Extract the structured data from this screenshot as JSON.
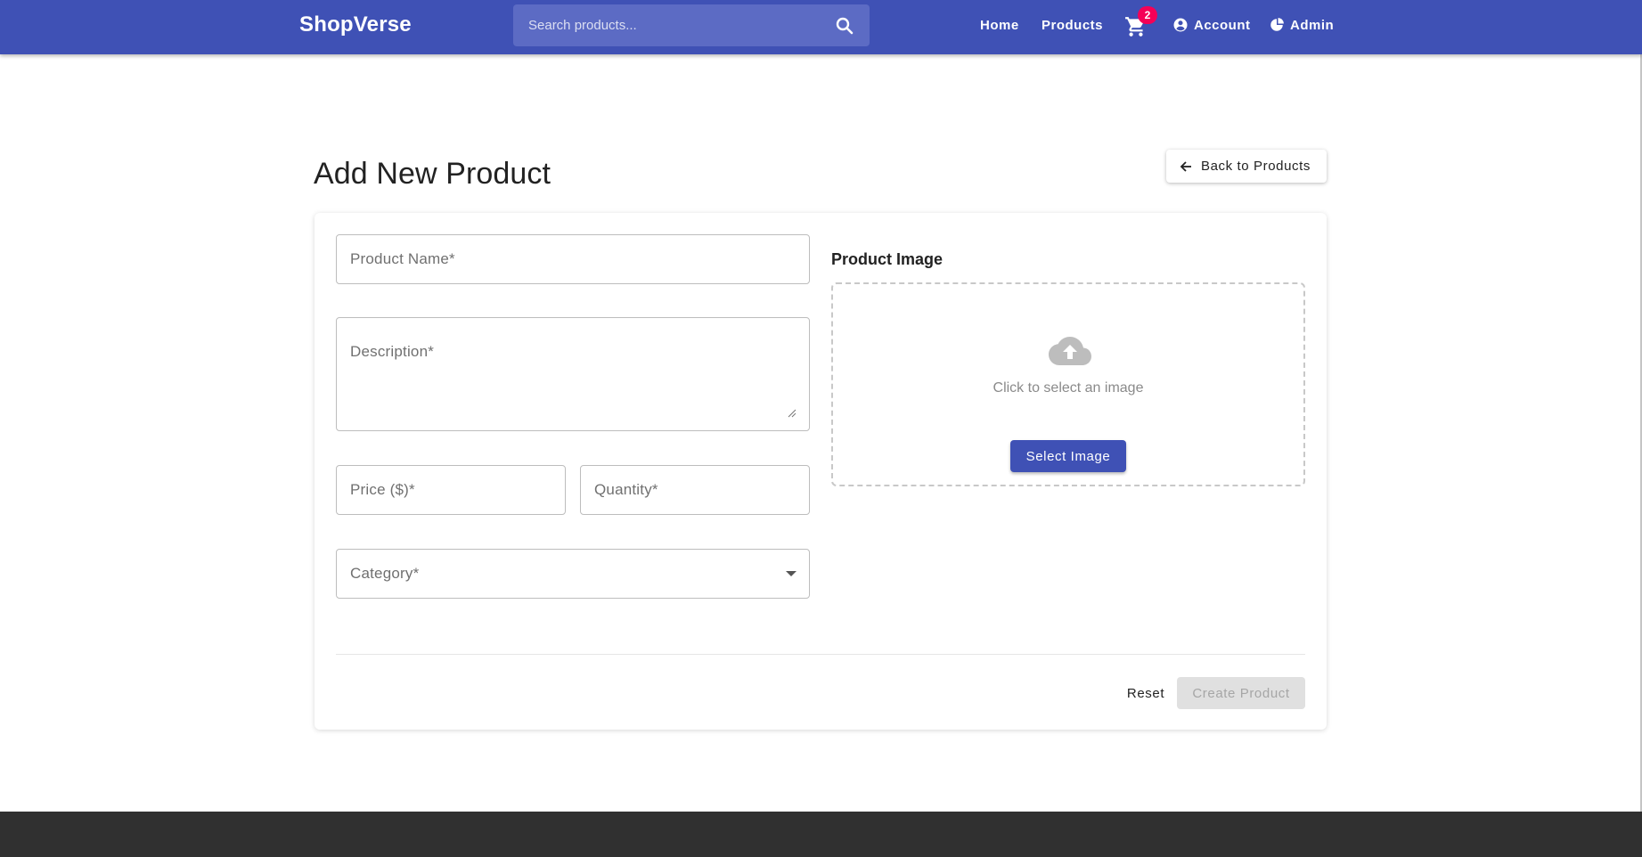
{
  "header": {
    "brand": "ShopVerse",
    "search_placeholder": "Search products...",
    "nav": {
      "home": "Home",
      "products": "Products",
      "cart_count": "2",
      "account": "Account",
      "admin": "Admin"
    }
  },
  "page": {
    "title": "Add New Product",
    "back_button": "Back to Products"
  },
  "form": {
    "product_name_label": "Product Name*",
    "description_label": "Description*",
    "price_label": "Price ($)*",
    "quantity_label": "Quantity*",
    "category_label": "Category*",
    "image_section_title": "Product Image",
    "dropzone_text": "Click to select an image",
    "select_image_button": "Select Image",
    "reset_button": "Reset",
    "create_button": "Create Product"
  },
  "colors": {
    "primary": "#3f51b5",
    "badge": "#f50057",
    "footer": "#303030"
  }
}
